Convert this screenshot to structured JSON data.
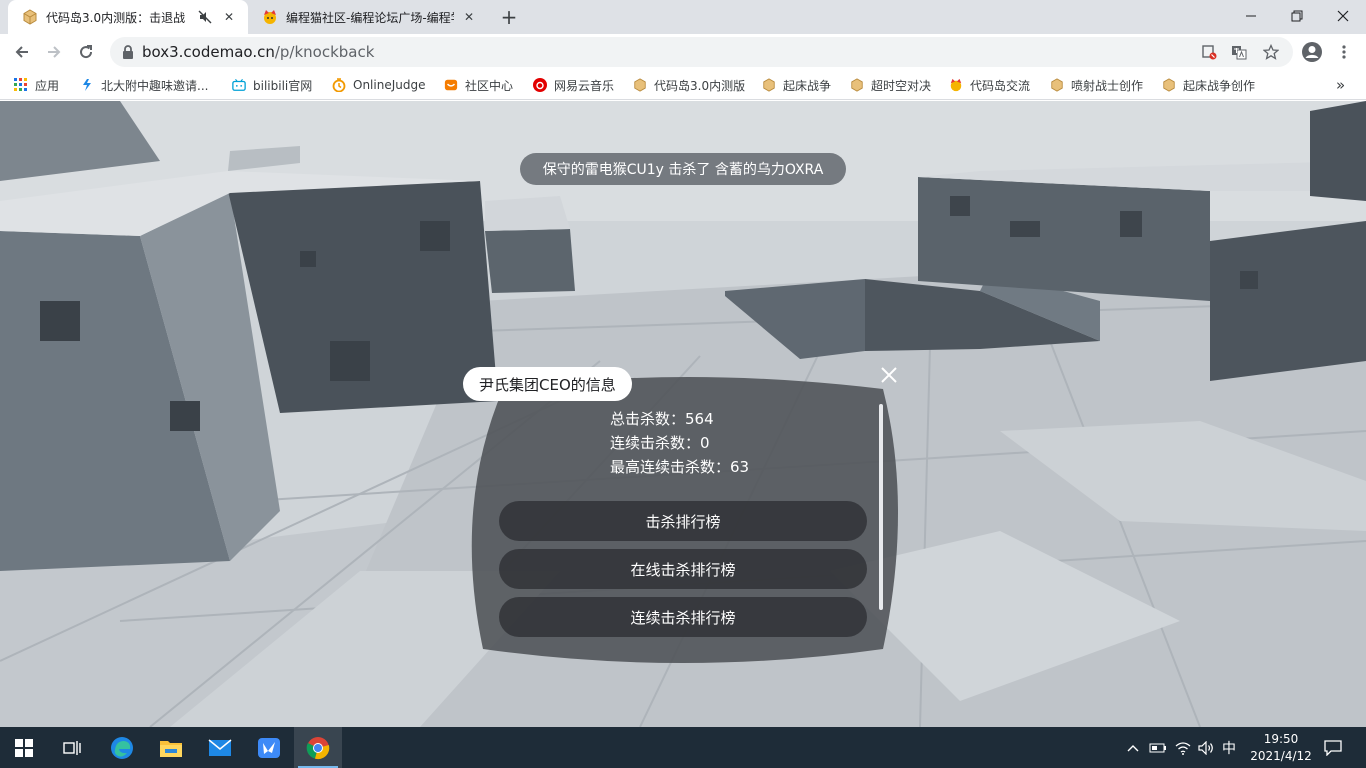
{
  "browser": {
    "tabs": [
      {
        "title": "代码岛3.0内测版：击退战",
        "icon": "codemao-box-icon",
        "muted": true
      },
      {
        "title": "编程猫社区-编程论坛广场-编程学",
        "icon": "codemao-cat-icon",
        "muted": false
      }
    ],
    "address": {
      "host": "box3.codemao.cn",
      "path": "/p/knockback"
    },
    "bookmarks": [
      {
        "label": "应用",
        "icon": "apps-grid-icon"
      },
      {
        "label": "北大附中趣味邀请...",
        "icon": "pku-icon"
      },
      {
        "label": "bilibili官网",
        "icon": "bilibili-icon"
      },
      {
        "label": "OnlineJudge",
        "icon": "onlinejudge-icon"
      },
      {
        "label": "社区中心",
        "icon": "community-icon"
      },
      {
        "label": "网易云音乐",
        "icon": "netease-music-icon"
      },
      {
        "label": "代码岛3.0内测版",
        "icon": "codemao-box-icon"
      },
      {
        "label": "起床战争",
        "icon": "codemao-box-icon"
      },
      {
        "label": "超时空对决",
        "icon": "codemao-box-icon"
      },
      {
        "label": "代码岛交流",
        "icon": "codemao-cat-icon"
      },
      {
        "label": "喷射战士创作",
        "icon": "codemao-box-icon"
      },
      {
        "label": "起床战争创作",
        "icon": "codemao-box-icon"
      }
    ],
    "more_bookmarks_label": "»"
  },
  "game": {
    "kill_feed": "保守的雷电猴CU1y 击杀了 含蓄的乌力OXRA",
    "player_panel": {
      "player_name": "尹氏集团CEO的信息",
      "stats": [
        "总击杀数：564",
        "连续击杀数：0",
        "最高连续击杀数：63"
      ],
      "buttons": [
        "击杀排行榜",
        "在线击杀排行榜",
        "连续击杀排行榜"
      ]
    }
  },
  "taskbar": {
    "ime": "中",
    "time": "19:50",
    "date": "2021/4/12"
  },
  "colors": {
    "accent_blue": "#1a73e8",
    "taskbar_bg": "#1e2c38",
    "panel_bg": "#4f5257"
  }
}
